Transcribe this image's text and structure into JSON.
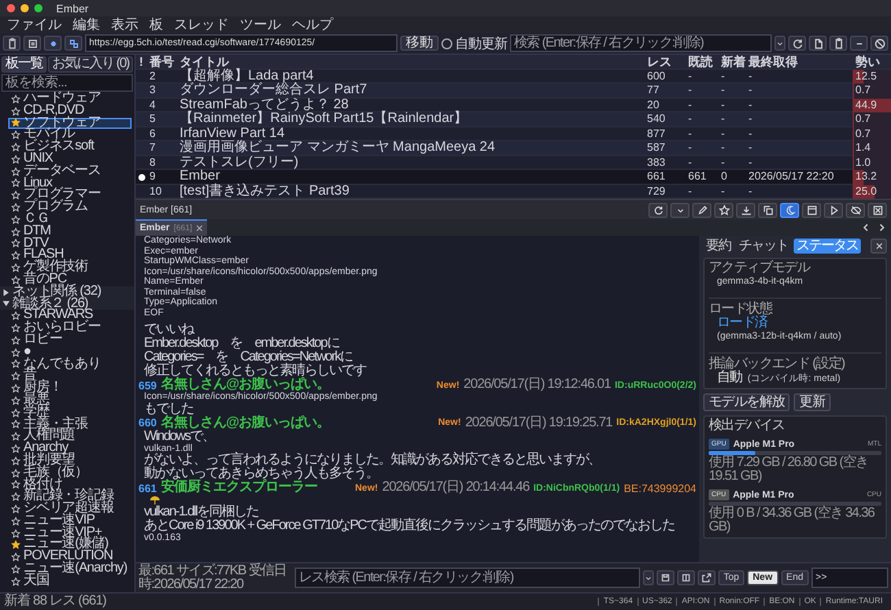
{
  "window": {
    "title": "Ember"
  },
  "menu": [
    "ファイル",
    "編集",
    "表示",
    "板",
    "スレッド",
    "ツール",
    "ヘルプ"
  ],
  "toolbar": {
    "url": "https://egg.5ch.io/test/read.cgi/software/1774690125/",
    "go_button": "移動",
    "auto_refresh": {
      "label": "自動更新",
      "checked": false
    },
    "search": {
      "placeholder": "検索 (Enter:保存 / 右クリック:削除)"
    }
  },
  "sidebar": {
    "tabs": [
      {
        "label": "板一覧",
        "selected": true
      },
      {
        "label": "お気に入り (0)",
        "selected": false
      }
    ],
    "search": {
      "placeholder": "板を検索..."
    },
    "tree": [
      {
        "kind": "board",
        "label": "ハードウェア",
        "starred": false,
        "selected": false
      },
      {
        "kind": "board",
        "label": "CD-R,DVD",
        "starred": false,
        "selected": false
      },
      {
        "kind": "board",
        "label": "ソフトウェア",
        "starred": true,
        "selected": true
      },
      {
        "kind": "board",
        "label": "モバイル",
        "starred": false,
        "selected": false
      },
      {
        "kind": "board",
        "label": "ビジネスsoft",
        "starred": false,
        "selected": false
      },
      {
        "kind": "board",
        "label": "UNIX",
        "starred": false,
        "selected": false
      },
      {
        "kind": "board",
        "label": "データベース",
        "starred": false,
        "selected": false
      },
      {
        "kind": "board",
        "label": "Linux",
        "starred": false,
        "selected": false
      },
      {
        "kind": "board",
        "label": "プログラマー",
        "starred": false,
        "selected": false
      },
      {
        "kind": "board",
        "label": "プログラム",
        "starred": false,
        "selected": false
      },
      {
        "kind": "board",
        "label": "ＣＧ",
        "starred": false,
        "selected": false
      },
      {
        "kind": "board",
        "label": "DTM",
        "starred": false,
        "selected": false
      },
      {
        "kind": "board",
        "label": "DTV",
        "starred": false,
        "selected": false
      },
      {
        "kind": "board",
        "label": "FLASH",
        "starred": false,
        "selected": false
      },
      {
        "kind": "board",
        "label": "ゲ製作技術",
        "starred": false,
        "selected": false
      },
      {
        "kind": "board",
        "label": "昔のPC",
        "starred": false,
        "selected": false
      },
      {
        "kind": "category",
        "label": "ネット関係 (32)",
        "expanded": false
      },
      {
        "kind": "category",
        "label": "雑談系２ (26)",
        "expanded": true,
        "children": [
          {
            "kind": "board",
            "label": "STARWARS",
            "starred": false,
            "selected": false
          },
          {
            "kind": "board",
            "label": "おいらロビー",
            "starred": false,
            "selected": false
          },
          {
            "kind": "board",
            "label": "ロビー",
            "starred": false,
            "selected": false
          },
          {
            "kind": "board",
            "label": "●",
            "starred": false,
            "selected": false
          },
          {
            "kind": "board",
            "label": "なんでもあり",
            "starred": false,
            "selected": false
          },
          {
            "kind": "board",
            "label": "昔",
            "starred": false,
            "selected": false
          },
          {
            "kind": "board",
            "label": "厨房！",
            "starred": false,
            "selected": false
          },
          {
            "kind": "board",
            "label": "最悪",
            "starred": false,
            "selected": false
          },
          {
            "kind": "board",
            "label": "学歴",
            "starred": false,
            "selected": false
          },
          {
            "kind": "board",
            "label": "主義・主張",
            "starred": false,
            "selected": false
          },
          {
            "kind": "board",
            "label": "人権問題",
            "starred": false,
            "selected": false
          },
          {
            "kind": "board",
            "label": "Anarchy",
            "starred": false,
            "selected": false
          },
          {
            "kind": "board",
            "label": "批判要望",
            "starred": false,
            "selected": false
          },
          {
            "kind": "board",
            "label": "毛族（仮）",
            "starred": false,
            "selected": false
          },
          {
            "kind": "board",
            "label": "格付け",
            "starred": false,
            "selected": false
          },
          {
            "kind": "board",
            "label": "新記録・珍記録",
            "starred": false,
            "selected": false
          },
          {
            "kind": "board",
            "label": "シベリア超速報",
            "starred": false,
            "selected": false
          },
          {
            "kind": "board",
            "label": "ニュー速VIP",
            "starred": false,
            "selected": false
          },
          {
            "kind": "board",
            "label": "ニュー速VIP+",
            "starred": false,
            "selected": false
          },
          {
            "kind": "board",
            "label": "ニュー速(嫌儲)",
            "starred": true,
            "selected": false
          },
          {
            "kind": "board",
            "label": "POVERLUTION",
            "starred": false,
            "selected": false
          },
          {
            "kind": "board",
            "label": "ニュー速(Anarchy)",
            "starred": false,
            "selected": false
          },
          {
            "kind": "board",
            "label": "天国",
            "starred": false,
            "selected": false
          }
        ]
      }
    ]
  },
  "thread_list": {
    "columns": [
      "!",
      "番号",
      "タイトル",
      "レス",
      "既読",
      "新着",
      "最終取得",
      "勢い"
    ],
    "rows": [
      {
        "opened": false,
        "selected": false,
        "number": "2",
        "title": "【超解像】Lada part4",
        "res": "600",
        "read": "-",
        "new": "-",
        "last_fetched": "-",
        "momentum": "12.5",
        "level": 0.28
      },
      {
        "opened": false,
        "selected": false,
        "number": "3",
        "title": "ダウンローダー総合スレ Part7",
        "res": "77",
        "read": "-",
        "new": "-",
        "last_fetched": "-",
        "momentum": "0.7",
        "level": 0.02
      },
      {
        "opened": false,
        "selected": false,
        "number": "4",
        "title": "StreamFabってどうよ？ 28",
        "res": "20",
        "read": "-",
        "new": "-",
        "last_fetched": "-",
        "momentum": "44.9",
        "level": 1
      },
      {
        "opened": false,
        "selected": false,
        "number": "5",
        "title": "【Rainmeter】RainySoft Part15【Rainlendar】",
        "res": "540",
        "read": "-",
        "new": "-",
        "last_fetched": "-",
        "momentum": "0.7",
        "level": 0.02
      },
      {
        "opened": false,
        "selected": false,
        "number": "6",
        "title": "IrfanView Part 14",
        "res": "877",
        "read": "-",
        "new": "-",
        "last_fetched": "-",
        "momentum": "0.7",
        "level": 0.02
      },
      {
        "opened": false,
        "selected": false,
        "number": "7",
        "title": "漫画用画像ビューア マンガミーヤ MangaMeeya 24",
        "res": "587",
        "read": "-",
        "new": "-",
        "last_fetched": "-",
        "momentum": "1.4",
        "level": 0.03
      },
      {
        "opened": false,
        "selected": false,
        "number": "8",
        "title": "テストスレ(フリー)",
        "res": "383",
        "read": "-",
        "new": "-",
        "last_fetched": "-",
        "momentum": "1.0",
        "level": 0.02
      },
      {
        "opened": true,
        "selected": true,
        "number": "9",
        "title": "Ember",
        "res": "661",
        "read": "661",
        "new": "0",
        "last_fetched": "2026/05/17 22:20",
        "momentum": "13.2",
        "level": 0.29
      },
      {
        "opened": false,
        "selected": false,
        "number": "10",
        "title": "[test]書き込みテスト Part39",
        "res": "729",
        "read": "-",
        "new": "-",
        "last_fetched": "-",
        "momentum": "25.0",
        "level": 0.56
      }
    ]
  },
  "thread_toolbar": {
    "title": "Ember [661]",
    "buttons": [
      {
        "active": false
      },
      {
        "active": false
      },
      {
        "active": false
      },
      {
        "active": false
      },
      {
        "active": false
      },
      {
        "active": false
      },
      {
        "active": true
      },
      {
        "active": false
      },
      {
        "active": false
      },
      {
        "active": false
      },
      {
        "active": false
      }
    ]
  },
  "tabs": [
    {
      "title": "Ember",
      "count": "[661]",
      "selected": true
    }
  ],
  "posts": [
    {
      "body": [
        {
          "kind": "ascii",
          "text": "Categories=Network"
        },
        {
          "kind": "ascii",
          "text": "Exec=ember"
        },
        {
          "kind": "ascii",
          "text": "StartupWMClass=ember"
        },
        {
          "kind": "ascii",
          "text": "Icon=/usr/share/icons/hicolor/500x500/apps/ember.png"
        },
        {
          "kind": "ascii",
          "text": "Name=Ember"
        },
        {
          "kind": "ascii",
          "text": "Terminal=false"
        },
        {
          "kind": "ascii",
          "text": "Type=Application"
        },
        {
          "kind": "ascii",
          "text": "EOF"
        },
        {
          "kind": "gap"
        },
        {
          "kind": "jp",
          "text": "でいいね"
        },
        {
          "kind": "jp",
          "text": "Ember.desktop　を　ember.desktopに"
        },
        {
          "kind": "jp",
          "text": "Categories=　を　Categories=Networkに"
        },
        {
          "kind": "jp",
          "text": "修正してくれるともっと素晴らしいです"
        }
      ]
    },
    {
      "number": "659",
      "name": "名無しさん@お腹いっぱい。",
      "new": "New!",
      "date": "2026/05/17(日) 19:12:46.01",
      "id": "ID:uRRuc0O0(2/2)",
      "color": "#3ec24a",
      "body": [
        {
          "kind": "ascii",
          "text": "Icon=/usr/share/icons/hicolor/500x500/apps/ember.png"
        },
        {
          "kind": "jp",
          "text": "もでした"
        }
      ]
    },
    {
      "number": "660",
      "name": "名無しさん@お腹いっぱい。",
      "new": "New!",
      "date": "2026/05/17(日) 19:19:25.71",
      "id": "ID:kA2HXgjl0(1/1)",
      "color": "#e0a020",
      "body": [
        {
          "kind": "jp",
          "text": "Windowsで、"
        },
        {
          "kind": "ascii",
          "text": "vulkan-1.dll"
        },
        {
          "kind": "jp",
          "text": "がないよ、って言われるようになりました。知識がある対応できると思いますが、"
        },
        {
          "kind": "jp",
          "text": "動かないってあきらめちゃう人も多そう。"
        }
      ]
    },
    {
      "number": "661",
      "name": "安価厨ミエクスプローラー",
      "new": "New!",
      "date": "2026/05/17(日) 20:14:44.46",
      "id": "ID:NiCbnRQb0(1/1)",
      "color": "#3ec24a",
      "be": "BE:743999204",
      "body": [
        {
          "kind": "emoji"
        },
        {
          "kind": "jp",
          "text": "vulkan-1.dllを同梱した"
        },
        {
          "kind": "jp",
          "text": "あとCore i9 13900K + GeForce GT710なPCで起動直後にクラッシュする問題があったのでなおした"
        },
        {
          "kind": "ascii",
          "text": "v0.0.163"
        }
      ]
    }
  ],
  "assistant": {
    "tabs": [
      {
        "label": "要約",
        "selected": false
      },
      {
        "label": "チャット",
        "selected": false
      },
      {
        "label": "ステータス",
        "selected": true
      }
    ],
    "fields": [
      {
        "label": "アクティブモデル",
        "value": "gemma3-4b-it-q4km"
      },
      {
        "label": "ロード状態",
        "status": {
          "text": "ロード済",
          "color": "#4aa3ff"
        },
        "value": "(gemma3-12b-it-q4km / auto)"
      },
      {
        "label": "推論バックエンド (設定)",
        "status": {
          "text": "自動",
          "color": "#e6e6e6"
        },
        "value": "(コンパイル時: metal)"
      }
    ],
    "buttons": [
      "モデルを解放",
      "更新"
    ],
    "devices_title": "検出デバイス",
    "devices": [
      {
        "type": "GPU",
        "name": "Apple M1 Pro",
        "tag": "MTL",
        "level": 0.27,
        "usage": "使用 7.29 GB / 26.80 GB (空き 19.51 GB)"
      },
      {
        "type": "CPU",
        "name": "Apple M1 Pro",
        "tag": "CPU",
        "level": 0,
        "usage": "使用 0 B / 34.36 GB (空き 34.36 GB)"
      }
    ]
  },
  "bottom_bar": {
    "info": "最:661 サイズ:77KB 受信日時:2026/05/17 22:20",
    "search": {
      "placeholder": "レス検索 (Enter:保存 / 右クリック:削除)"
    },
    "jump_buttons": [
      {
        "label": "Top",
        "selected": false
      },
      {
        "label": "New",
        "selected": true
      },
      {
        "label": "End",
        "selected": false
      }
    ],
    "anchor": {
      "value": ">>"
    }
  },
  "status_bar": {
    "left": "新着 88 レス (661)",
    "items": [
      "TS~364",
      "US~362",
      "API:ON",
      "Ronin:OFF",
      "BE:ON",
      "OK",
      "Runtime:TAURI"
    ]
  }
}
